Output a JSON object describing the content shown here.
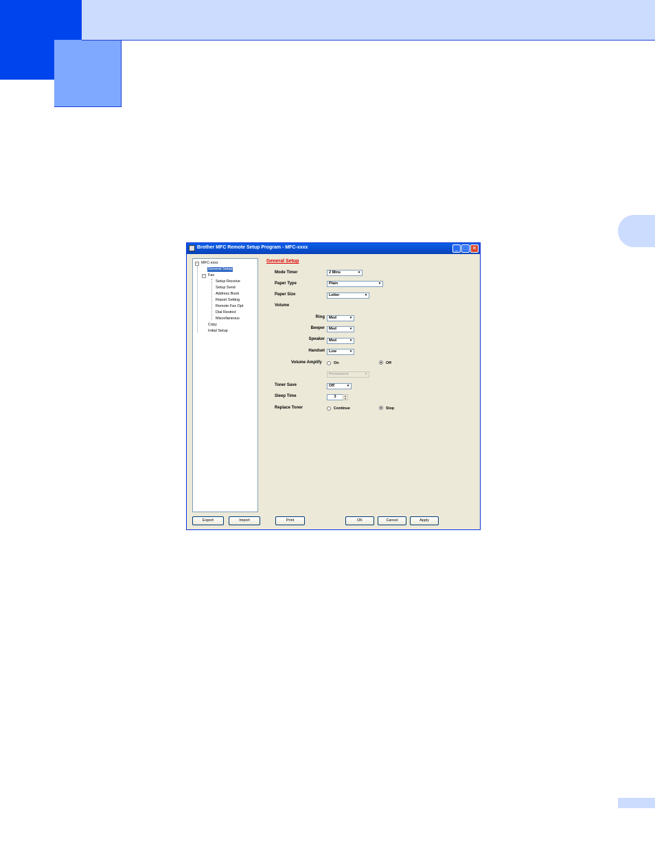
{
  "window": {
    "title": "Brother MFC Remote Setup Program - MFC-xxxx",
    "minimize": "_",
    "maximize": "□",
    "close": "✕"
  },
  "tree": {
    "root": "MFC-xxxx",
    "items": [
      "General Setup",
      "Fax",
      "Setup Receive",
      "Setup Send",
      "Address Book",
      "Report Setting",
      "Remote Fax Opt",
      "Dial Restrict",
      "Miscellaneous",
      "Copy",
      "Initial Setup"
    ],
    "selected": "General Setup"
  },
  "general_setup": {
    "title": "General Setup",
    "mode_timer": {
      "label": "Mode Timer",
      "value": "2 Mins"
    },
    "paper_type": {
      "label": "Paper Type",
      "value": "Plain"
    },
    "paper_size": {
      "label": "Paper Size",
      "value": "Letter"
    },
    "volume": {
      "label": "Volume",
      "ring": {
        "label": "Ring",
        "value": "Med"
      },
      "beeper": {
        "label": "Beeper",
        "value": "Med"
      },
      "speaker": {
        "label": "Speaker",
        "value": "Med"
      },
      "handset": {
        "label": "Handset",
        "value": "Low"
      },
      "amplify": {
        "label": "Volume Amplify",
        "on": "On",
        "off": "Off",
        "selected": "Off",
        "duration": "Permanent"
      }
    },
    "toner_save": {
      "label": "Toner Save",
      "value": "Off"
    },
    "sleep_time": {
      "label": "Sleep Time",
      "value": "3"
    },
    "replace_toner": {
      "label": "Replace Toner",
      "continue": "Continue",
      "stop": "Stop",
      "selected": "Stop"
    }
  },
  "buttons": {
    "export": "Export",
    "import": "Import",
    "print": "Print",
    "ok": "OK",
    "cancel": "Cancel",
    "apply": "Apply"
  },
  "arrow": "▾",
  "spin_up": "▲",
  "spin_down": "▼",
  "expander": "−"
}
